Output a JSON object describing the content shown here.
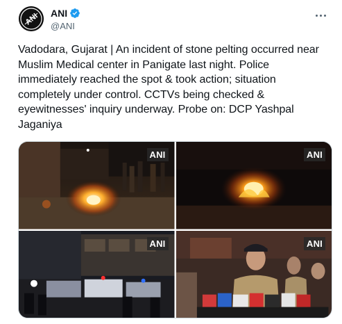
{
  "author": {
    "display_name": "ANI",
    "handle": "@ANI",
    "verified": true,
    "avatar_icon": "ani-logo-icon",
    "avatar_text": "ANI"
  },
  "tweet": {
    "text": "Vadodara, Gujarat | An incident of stone pelting occurred near Muslim Medical center in Panigate last night. Police immediately reached the spot & took action; situation completely under control. CCTVs being checked & eyewitnesses' inquiry underway. Probe on: DCP Yashpal Jaganiya"
  },
  "media": [
    {
      "watermark": "ANI"
    },
    {
      "watermark": "ANI"
    },
    {
      "watermark": "ANI"
    },
    {
      "watermark": "ANI"
    }
  ],
  "colors": {
    "verified": "#1d9bf0",
    "text": "#0f1419",
    "secondary": "#536471"
  },
  "icons": {
    "more": "more-options-icon",
    "verified": "verified-badge-icon"
  }
}
